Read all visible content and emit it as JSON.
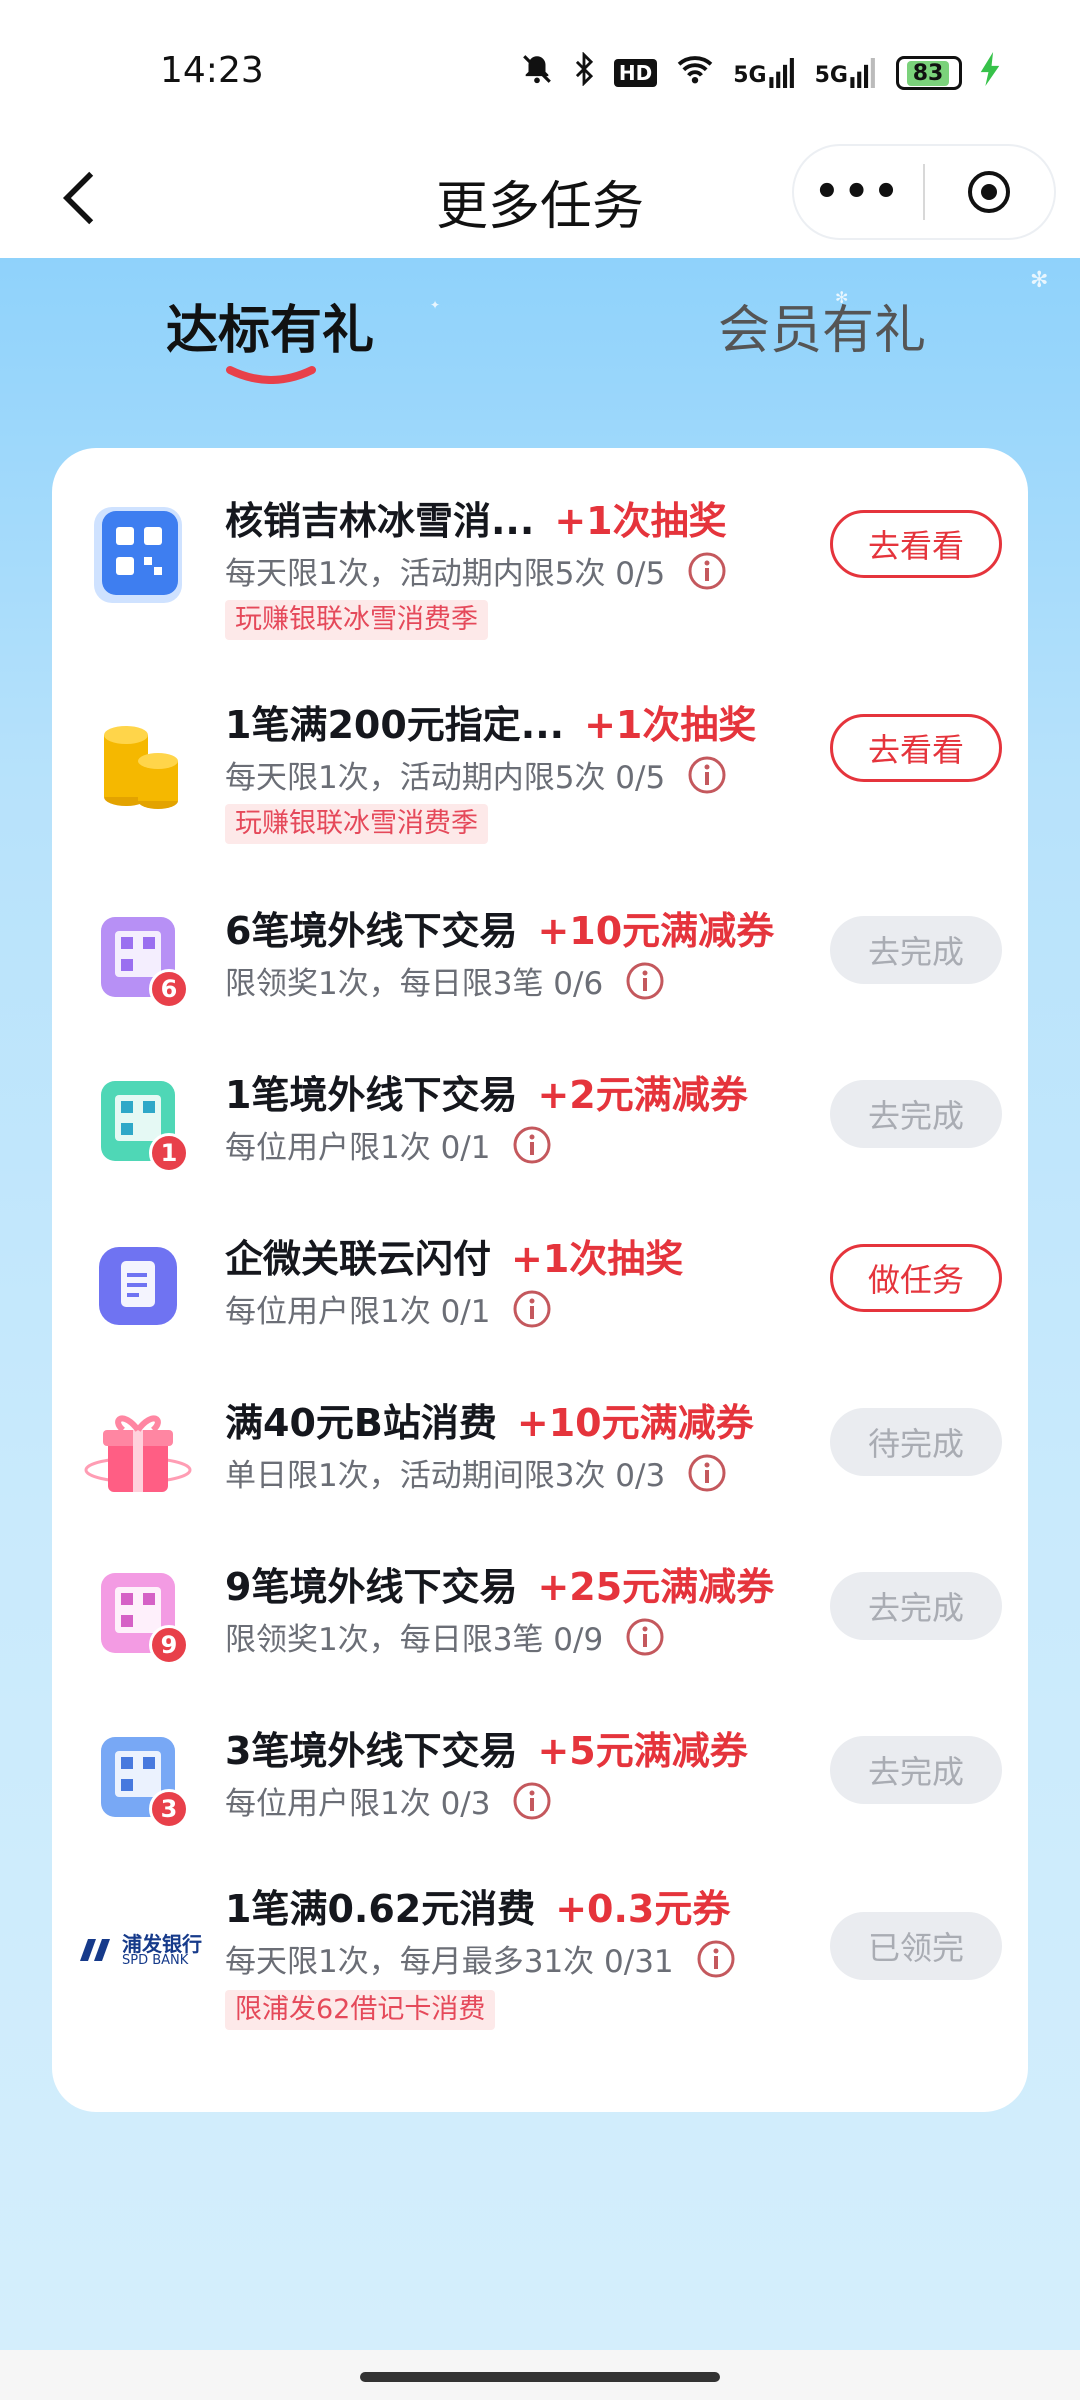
{
  "status": {
    "time": "14:23",
    "battery": "83",
    "icons": [
      "bell-off-icon",
      "bluetooth-icon",
      "hd-icon",
      "wifi-icon",
      "signal-5g-icon",
      "signal-5g-icon",
      "battery-icon",
      "charging-icon"
    ],
    "hd_label": "HD",
    "sig_label": "5G"
  },
  "titlebar": {
    "title": "更多任务",
    "more_label": "•••"
  },
  "tabs": [
    {
      "label": "达标有礼",
      "active": true
    },
    {
      "label": "会员有礼",
      "active": false
    }
  ],
  "tasks": [
    {
      "title": "核销吉林冰雪消...",
      "reward": "+1次抽奖",
      "desc": "每天限1次，活动期内限5次 0/5",
      "tag": "玩赚银联冰雪消费季",
      "button": "去看看",
      "button_state": "outline",
      "icon": "qr-code-icon"
    },
    {
      "title": "1笔满200元指定...",
      "reward": "+1次抽奖",
      "desc": "每天限1次，活动期内限5次 0/5",
      "tag": "玩赚银联冰雪消费季",
      "button": "去看看",
      "button_state": "outline",
      "icon": "gold-coins-icon"
    },
    {
      "title": "6笔境外线下交易",
      "reward": "+10元满减券",
      "desc": "限领奖1次，每日限3笔 0/6",
      "tag": "",
      "button": "去完成",
      "button_state": "disabled",
      "icon": "purple-qr-icon",
      "badge": "6"
    },
    {
      "title": "1笔境外线下交易",
      "reward": "+2元满减券",
      "desc": "每位用户限1次 0/1",
      "tag": "",
      "button": "去完成",
      "button_state": "disabled",
      "icon": "green-qr-icon",
      "badge": "1"
    },
    {
      "title": "企微关联云闪付",
      "reward": "+1次抽奖",
      "desc": "每位用户限1次 0/1",
      "tag": "",
      "button": "做任务",
      "button_state": "outline",
      "icon": "document-icon"
    },
    {
      "title": "满40元B站消费",
      "reward": "+10元满减券",
      "desc": "单日限1次，活动期间限3次 0/3",
      "tag": "",
      "button": "待完成",
      "button_state": "disabled",
      "icon": "gift-box-icon"
    },
    {
      "title": "9笔境外线下交易",
      "reward": "+25元满减券",
      "desc": "限领奖1次，每日限3笔 0/9",
      "tag": "",
      "button": "去完成",
      "button_state": "disabled",
      "icon": "pink-qr-icon",
      "badge": "9"
    },
    {
      "title": "3笔境外线下交易",
      "reward": "+5元满减券",
      "desc": "每位用户限1次 0/3",
      "tag": "",
      "button": "去完成",
      "button_state": "disabled",
      "icon": "blue-qr-icon",
      "badge": "3"
    },
    {
      "title": "1笔满0.62元消费",
      "reward": "+0.3元券",
      "desc": "每天限1次，每月最多31次 0/31",
      "tag": "限浦发62借记卡消费",
      "button": "已领完",
      "button_state": "disabled",
      "icon": "spd-bank-logo",
      "logo_cn": "浦发银行",
      "logo_en": "SPD BANK"
    }
  ],
  "colors": {
    "accent_red": "#e5343c",
    "tag_bg": "#fde9e9",
    "bg_blue": "#8fd2fb"
  }
}
